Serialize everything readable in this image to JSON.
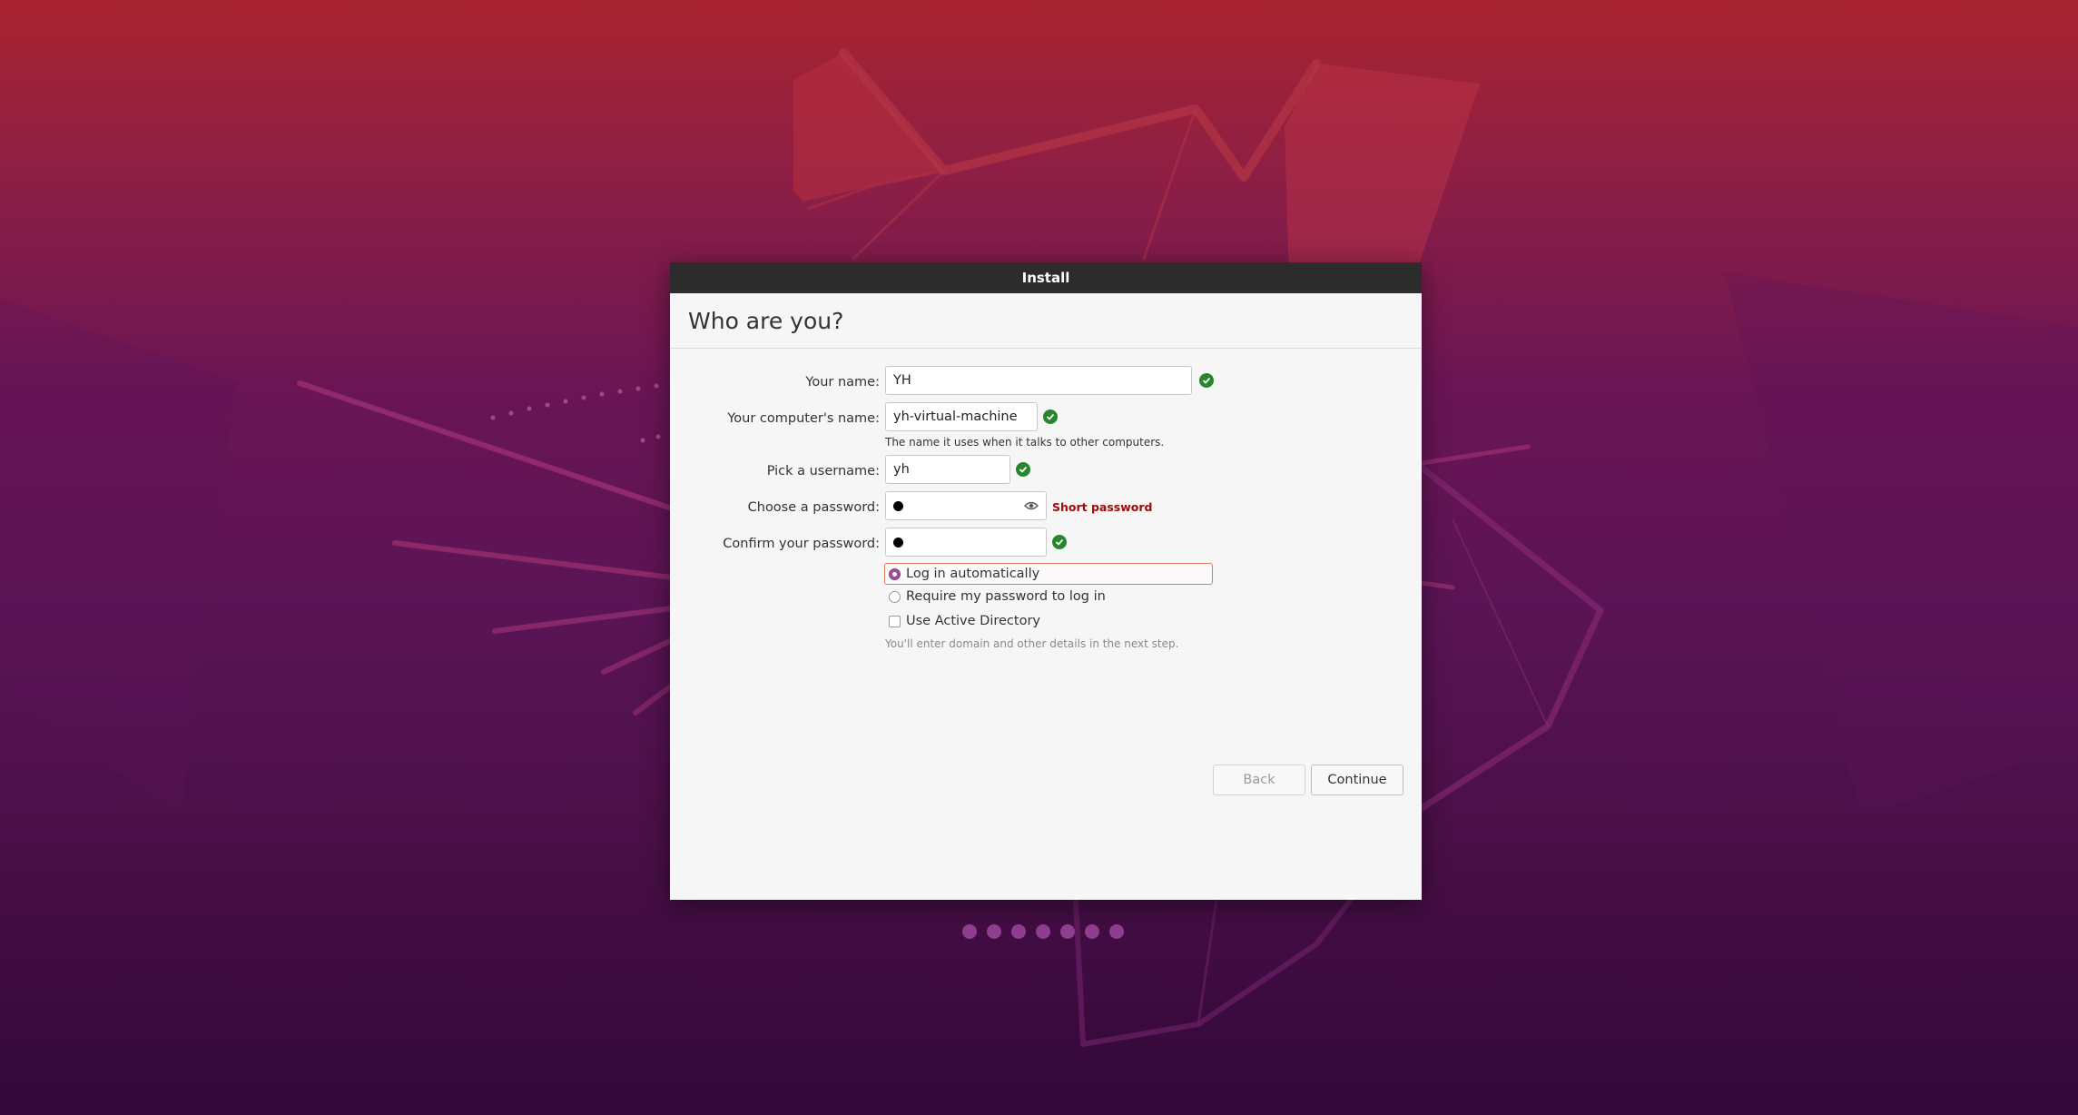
{
  "window": {
    "title": "Install"
  },
  "page": {
    "heading": "Who are you?"
  },
  "form": {
    "name_label": "Your name:",
    "name_value": "YH",
    "computer_label": "Your computer's name:",
    "computer_value": "yh-virtual-machine",
    "computer_hint": "The name it uses when it talks to other computers.",
    "username_label": "Pick a username:",
    "username_value": "yh",
    "password_label": "Choose a password:",
    "password_strength": "Short password",
    "confirm_label": "Confirm your password:",
    "login_auto_label": "Log in automatically",
    "login_require_label": "Require my password to log in",
    "active_directory_label": "Use Active Directory",
    "active_directory_hint": "You'll enter domain and other details in the next step.",
    "login_selected": "Log in automatically",
    "active_directory_checked": false
  },
  "buttons": {
    "back": "Back",
    "continue": "Continue"
  },
  "progress": {
    "steps_total": 7,
    "steps_completed": 7
  },
  "colors": {
    "accent": "#8f3e8f",
    "valid_check": "#26852d",
    "warning_text": "#a10a0a",
    "titlebar": "#2c2c2c",
    "focus_border": "#e07a5f"
  },
  "icons": {
    "valid": "check-circle-icon",
    "show_password": "eye-icon"
  }
}
